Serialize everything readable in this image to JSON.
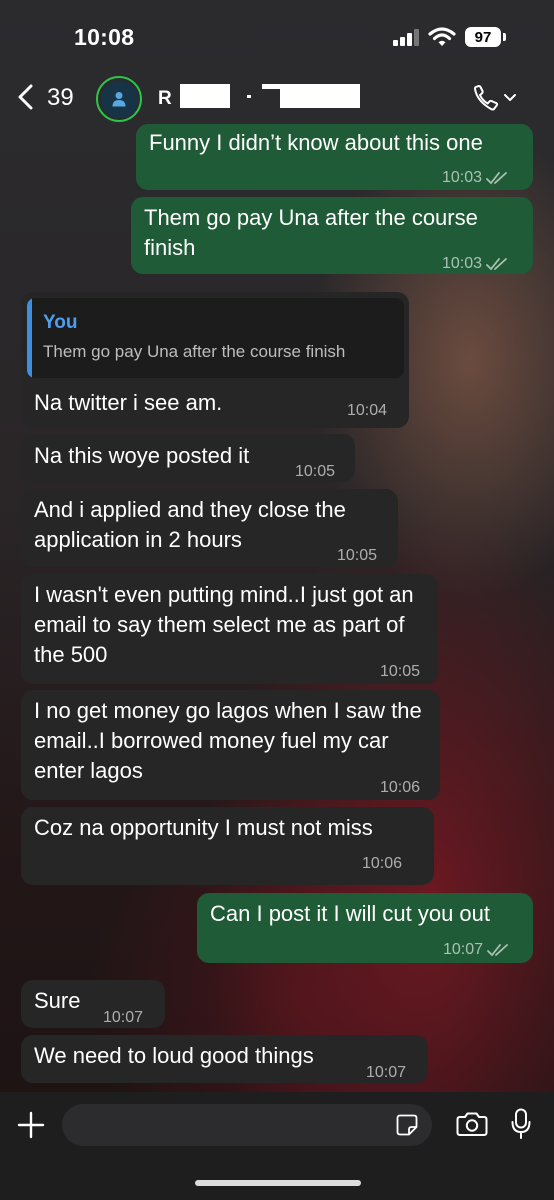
{
  "status": {
    "time": "10:08",
    "battery": "97"
  },
  "header": {
    "unread_count": "39",
    "contact_initial": "R"
  },
  "messages": [
    {
      "dir": "out",
      "text": "Funny I didn’t know about this one",
      "time": "10:03"
    },
    {
      "dir": "out",
      "text": "Them go pay Una after the course finish",
      "time": "10:03"
    },
    {
      "dir": "in",
      "quote_author": "You",
      "quote_text": "Them go pay Una after the course finish",
      "text": "Na twitter i see am.",
      "time": "10:04"
    },
    {
      "dir": "in",
      "text": "Na this woye posted it",
      "time": "10:05"
    },
    {
      "dir": "in",
      "text": "And i applied and they close the application in 2 hours",
      "time": "10:05"
    },
    {
      "dir": "in",
      "text": "I wasn't even putting mind..I just got an email to say them select me as part of the 500",
      "time": "10:05"
    },
    {
      "dir": "in",
      "text": "I no get money go lagos when I saw the email..I borrowed money fuel my car enter lagos",
      "time": "10:06"
    },
    {
      "dir": "in",
      "text": "Coz na opportunity I must not miss",
      "time": "10:06"
    },
    {
      "dir": "out",
      "text": "Can I post it I will cut you out",
      "time": "10:07"
    },
    {
      "dir": "in",
      "text": "Sure",
      "time": "10:07"
    },
    {
      "dir": "in",
      "text": "We need to loud good things",
      "time": "10:07"
    }
  ],
  "colors": {
    "outgoing": "#1f5b36",
    "incoming": "#262626",
    "online_ring": "#2cc44a",
    "quote_accent": "#4c9ff0"
  },
  "icons": [
    "back-chevron-icon",
    "person-icon",
    "phone-icon",
    "chevron-down-icon",
    "plus-icon",
    "sticker-icon",
    "camera-icon",
    "mic-icon",
    "double-check-icon"
  ]
}
